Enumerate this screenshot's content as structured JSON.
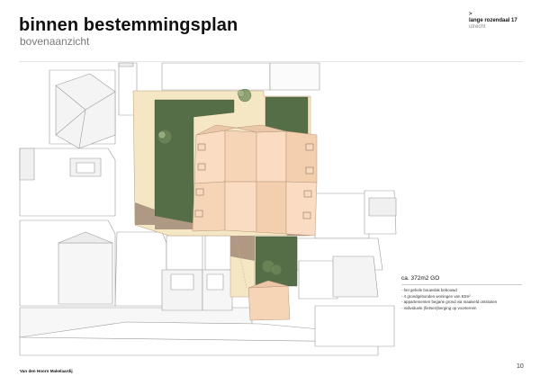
{
  "header": {
    "title": "binnen bestemmingsplan",
    "subtitle": "bovenaanzicht"
  },
  "project": {
    "marker": ">",
    "street": "lange rozendaal 17",
    "city": "utrecht"
  },
  "summary": {
    "area": "ca. 372m2 GO",
    "bullets": [
      "- het gehele bouwvlak bebouwd",
      "- 4 grondgebonden woningen van 93m²",
      "- appartementen begane grond via maaiveld ontsluiten",
      "- individuele (fietsen)berging op voorterrein"
    ]
  },
  "footer": {
    "brand": "Van den Hoorn Makelaardij",
    "page": "10"
  },
  "colors": {
    "zone_beige": "#f6e7c4",
    "garden_green": "#566e47",
    "garden_green_dark": "#3f5535",
    "roof_light": "#f9dcc1",
    "roof_mid": "#f3cfae",
    "ground_shadow": "#a8917f",
    "building_white": "#ffffff",
    "building_shade": "#e6e6e6",
    "outline": "#9a9a9a"
  }
}
